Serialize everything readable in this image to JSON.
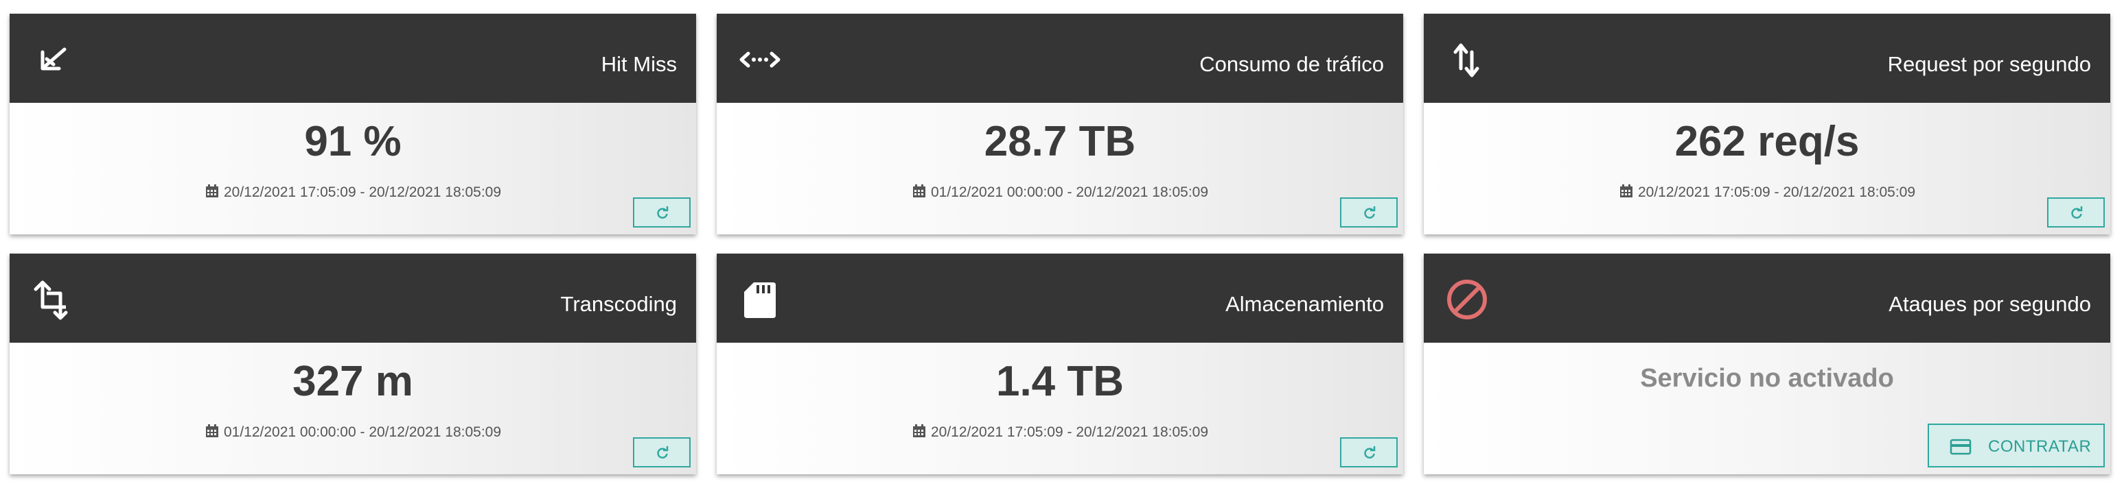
{
  "cards": [
    {
      "title": "Hit Miss",
      "icon": "check-arrow-icon",
      "value": "91 %",
      "range": "20/12/2021 17:05:09 - 20/12/2021 18:05:09",
      "action": "refresh"
    },
    {
      "title": "Consumo de tráfico",
      "icon": "code-arrows-icon",
      "value": "28.7 TB",
      "range": "01/12/2021 00:00:00 - 20/12/2021 18:05:09",
      "action": "refresh"
    },
    {
      "title": "Request por segundo",
      "icon": "up-down-arrows-icon",
      "value": "262 req/s",
      "range": "20/12/2021 17:05:09 - 20/12/2021 18:05:09",
      "action": "refresh"
    },
    {
      "title": "Transcoding",
      "icon": "crop-icon",
      "value": "327 m",
      "range": "01/12/2021 00:00:00 - 20/12/2021 18:05:09",
      "action": "refresh"
    },
    {
      "title": "Almacenamiento",
      "icon": "sd-card-icon",
      "value": "1.4 TB",
      "range": "20/12/2021 17:05:09 - 20/12/2021 18:05:09",
      "action": "refresh"
    },
    {
      "title": "Ataques por segundo",
      "icon": "ban-icon",
      "value": "Servicio no activado",
      "range": "",
      "action": "contract",
      "action_label": "CONTRATAR"
    }
  ],
  "colors": {
    "header_bg": "#353535",
    "accent": "#2fa89f",
    "accent_bg": "#d6eeec",
    "ban_icon": "#e07070"
  }
}
